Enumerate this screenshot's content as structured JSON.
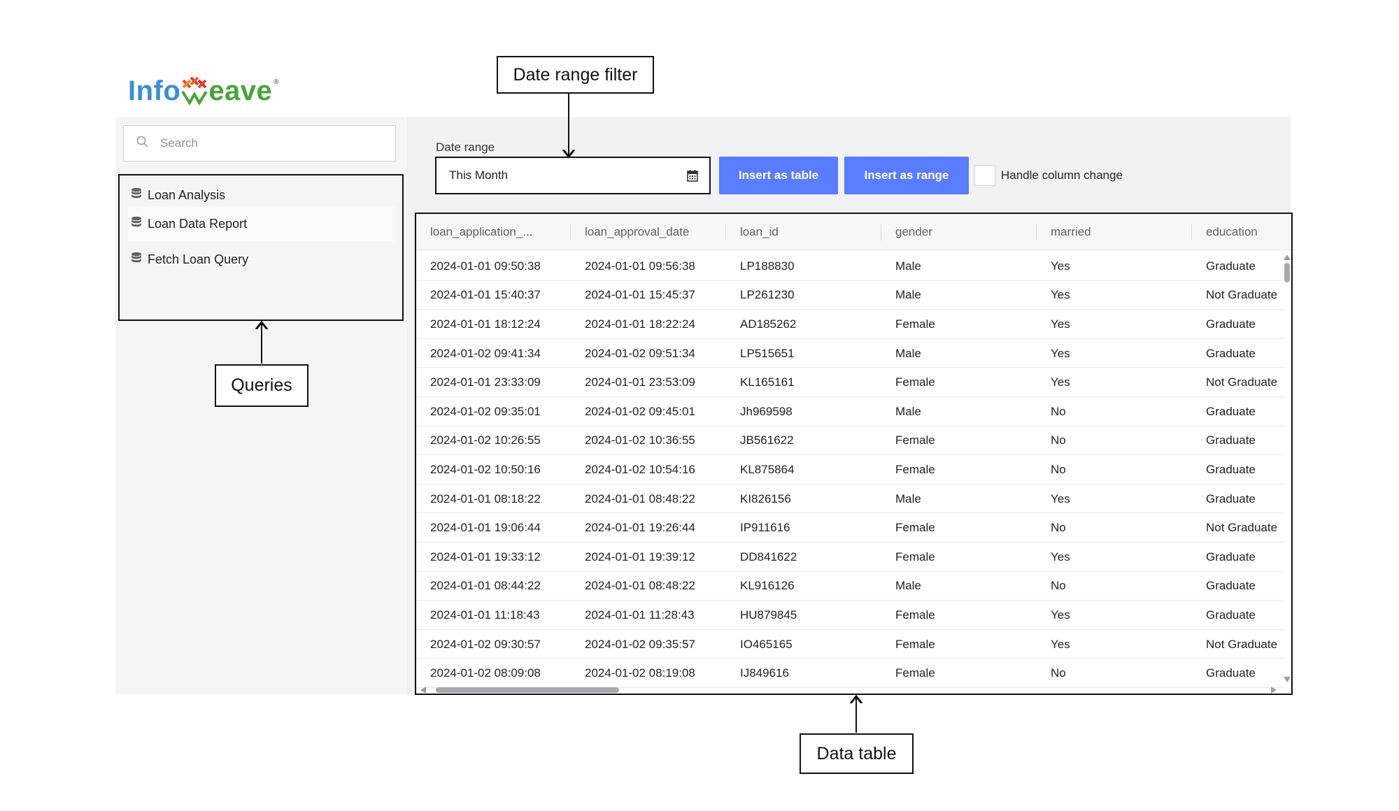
{
  "logo": {
    "part1": "Info",
    "part2": "eave",
    "reg": "®"
  },
  "search": {
    "placeholder": "Search"
  },
  "queries": [
    {
      "label": "Loan Analysis"
    },
    {
      "label": "Loan Data Report"
    },
    {
      "label": "Fetch Loan Query"
    }
  ],
  "filter": {
    "label": "Date range",
    "value": "This Month",
    "insert_table": "Insert as table",
    "insert_range": "Insert as range",
    "handle_label": "Handle column change"
  },
  "table": {
    "columns": [
      "loan_application_...",
      "loan_approval_date",
      "loan_id",
      "gender",
      "married",
      "education"
    ],
    "rows": [
      [
        "2024-01-01 09:50:38",
        "2024-01-01 09:56:38",
        "LP188830",
        "Male",
        "Yes",
        "Graduate"
      ],
      [
        "2024-01-01 15:40:37",
        "2024-01-01 15:45:37",
        "LP261230",
        "Male",
        "Yes",
        "Not Graduate"
      ],
      [
        "2024-01-01 18:12:24",
        "2024-01-01 18:22:24",
        "AD185262",
        "Female",
        "Yes",
        "Graduate"
      ],
      [
        "2024-01-02 09:41:34",
        "2024-01-02 09:51:34",
        "LP515651",
        "Male",
        "Yes",
        "Graduate"
      ],
      [
        "2024-01-01 23:33:09",
        "2024-01-01 23:53:09",
        "KL165161",
        "Female",
        "Yes",
        "Not Graduate"
      ],
      [
        "2024-01-02 09:35:01",
        "2024-01-02 09:45:01",
        "Jh969598",
        "Male",
        "No",
        "Graduate"
      ],
      [
        "2024-01-02 10:26:55",
        "2024-01-02 10:36:55",
        "JB561622",
        "Female",
        "No",
        "Graduate"
      ],
      [
        "2024-01-02 10:50:16",
        "2024-01-02 10:54:16",
        "KL875864",
        "Female",
        "No",
        "Graduate"
      ],
      [
        "2024-01-01 08:18:22",
        "2024-01-01 08:48:22",
        "KI826156",
        "Male",
        "Yes",
        "Graduate"
      ],
      [
        "2024-01-01 19:06:44",
        "2024-01-01 19:26:44",
        "IP911616",
        "Female",
        "No",
        "Not Graduate"
      ],
      [
        "2024-01-01 19:33:12",
        "2024-01-01 19:39:12",
        "DD841622",
        "Female",
        "Yes",
        "Graduate"
      ],
      [
        "2024-01-01 08:44:22",
        "2024-01-01 08:48:22",
        "KL916126",
        "Male",
        "No",
        "Graduate"
      ],
      [
        "2024-01-01 11:18:43",
        "2024-01-01 11:28:43",
        "HU879845",
        "Female",
        "Yes",
        "Graduate"
      ],
      [
        "2024-01-02 09:30:57",
        "2024-01-02 09:35:57",
        "IO465165",
        "Female",
        "Yes",
        "Not Graduate"
      ],
      [
        "2024-01-02 08:09:08",
        "2024-01-02 08:19:08",
        "IJ849616",
        "Female",
        "No",
        "Graduate"
      ]
    ]
  },
  "annotations": {
    "date_range_filter": "Date range filter",
    "queries": "Queries",
    "data_table": "Data table"
  },
  "colors": {
    "button": "#5a7cff",
    "logo_blue": "#3a8fd0",
    "logo_green": "#47a33b"
  }
}
